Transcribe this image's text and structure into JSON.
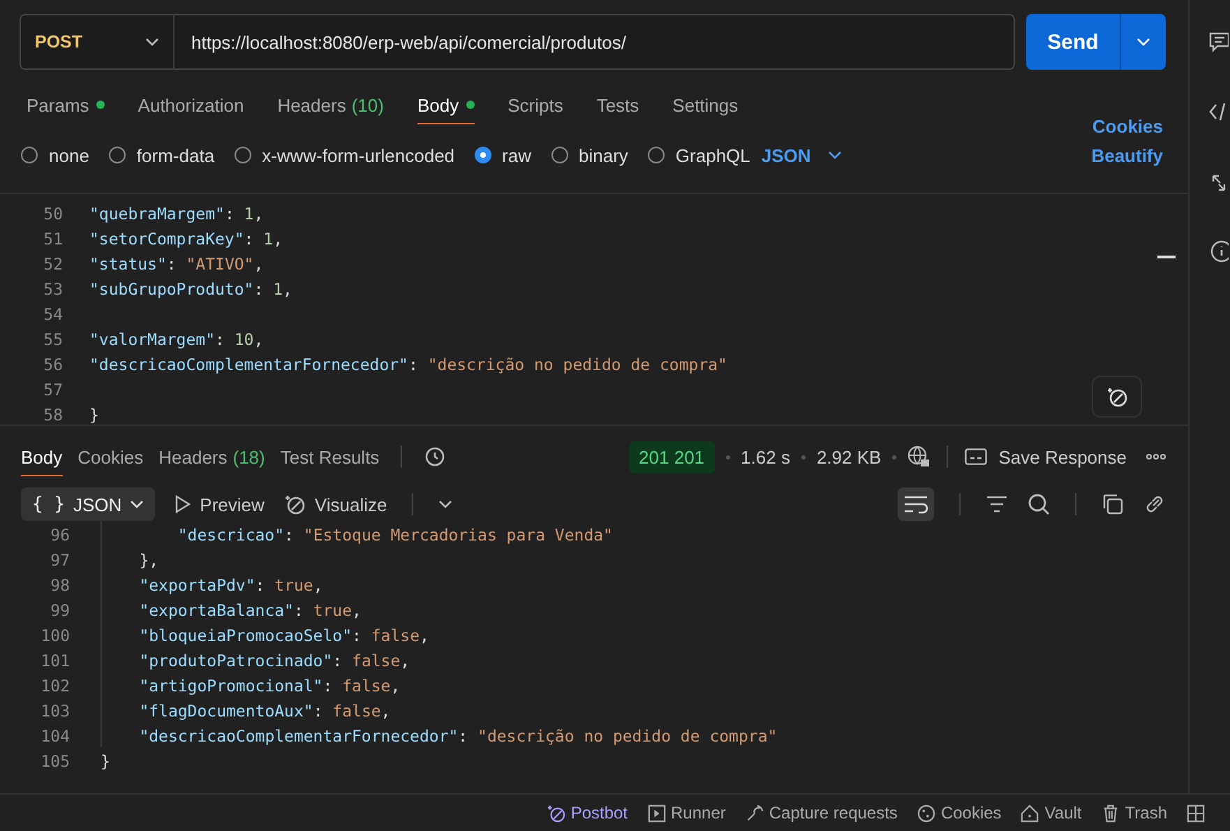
{
  "request": {
    "method": "POST",
    "url": "https://localhost:8080/erp-web/api/comercial/produtos/",
    "send": "Send"
  },
  "request_tabs": [
    {
      "label": "Params",
      "dot": true,
      "selected": false
    },
    {
      "label": "Authorization",
      "dot": false,
      "selected": false
    },
    {
      "label": "Headers",
      "count": "(10)",
      "dot": false,
      "selected": false
    },
    {
      "label": "Body",
      "dot": true,
      "selected": true
    },
    {
      "label": "Scripts",
      "dot": false,
      "selected": false
    },
    {
      "label": "Tests",
      "dot": false,
      "selected": false
    },
    {
      "label": "Settings",
      "dot": false,
      "selected": false
    }
  ],
  "cookies_link": "Cookies",
  "beautify_link": "Beautify",
  "body_types": [
    {
      "label": "none",
      "selected": false
    },
    {
      "label": "form-data",
      "selected": false
    },
    {
      "label": "x-www-form-urlencoded",
      "selected": false
    },
    {
      "label": "raw",
      "selected": true
    },
    {
      "label": "binary",
      "selected": false
    },
    {
      "label": "GraphQL",
      "selected": false
    }
  ],
  "body_format": "JSON",
  "request_body": [
    {
      "num": "50",
      "tokens": [
        {
          "kind": "key",
          "text": "\"quebraMargem\""
        },
        {
          "kind": "punct",
          "text": ": "
        },
        {
          "kind": "number",
          "text": "1"
        },
        {
          "kind": "punct",
          "text": ","
        }
      ]
    },
    {
      "num": "51",
      "tokens": [
        {
          "kind": "key",
          "text": "\"setorCompraKey\""
        },
        {
          "kind": "punct",
          "text": ": "
        },
        {
          "kind": "number",
          "text": "1"
        },
        {
          "kind": "punct",
          "text": ","
        }
      ]
    },
    {
      "num": "52",
      "tokens": [
        {
          "kind": "key",
          "text": "\"status\""
        },
        {
          "kind": "punct",
          "text": ": "
        },
        {
          "kind": "string",
          "text": "\"ATIVO\""
        },
        {
          "kind": "punct",
          "text": ","
        }
      ]
    },
    {
      "num": "53",
      "tokens": [
        {
          "kind": "key",
          "text": "\"subGrupoProduto\""
        },
        {
          "kind": "punct",
          "text": ": "
        },
        {
          "kind": "number",
          "text": "1"
        },
        {
          "kind": "punct",
          "text": ","
        }
      ]
    },
    {
      "num": "54"
    },
    {
      "num": "55",
      "tokens": [
        {
          "kind": "key",
          "text": "\"valorMargem\""
        },
        {
          "kind": "punct",
          "text": ": "
        },
        {
          "kind": "number",
          "text": "10"
        },
        {
          "kind": "punct",
          "text": ","
        }
      ]
    },
    {
      "num": "56",
      "tokens": [
        {
          "kind": "key",
          "text": "\"descricaoComplementarFornecedor\""
        },
        {
          "kind": "punct",
          "text": ": "
        },
        {
          "kind": "string",
          "text": "\"descrição no pedido de compra\""
        }
      ]
    },
    {
      "num": "57"
    },
    {
      "num": "58",
      "tokens": [
        {
          "kind": "punct",
          "text": "}"
        }
      ]
    }
  ],
  "response_tabs": [
    {
      "label": "Body",
      "selected": true
    },
    {
      "label": "Cookies",
      "selected": false
    },
    {
      "label": "Headers",
      "count": "(18)",
      "selected": false
    },
    {
      "label": "Test Results",
      "selected": false
    }
  ],
  "response_meta": {
    "status": "201 201",
    "time": "1.62 s",
    "size": "2.92 KB",
    "save": "Save Response"
  },
  "response_view": {
    "format_icon": "{ }",
    "format": "JSON",
    "preview": "Preview",
    "visualize": "Visualize"
  },
  "response_body": [
    {
      "children": [
        {
          "children": [
            {
              "num": "96",
              "tokens": [
                {
                  "kind": "key",
                  "text": "\"descricao\""
                },
                {
                  "kind": "punct",
                  "text": ": "
                },
                {
                  "kind": "string",
                  "text": "\"Estoque Mercadorias para Venda\""
                }
              ]
            }
          ]
        },
        {
          "num": "97",
          "tokens": [
            {
              "kind": "punct",
              "text": "},"
            }
          ]
        },
        {
          "num": "98",
          "tokens": [
            {
              "kind": "key",
              "text": "\"exportaPdv\""
            },
            {
              "kind": "punct",
              "text": ": "
            },
            {
              "kind": "bool",
              "text": "true"
            },
            {
              "kind": "punct",
              "text": ","
            }
          ]
        },
        {
          "num": "99",
          "tokens": [
            {
              "kind": "key",
              "text": "\"exportaBalanca\""
            },
            {
              "kind": "punct",
              "text": ": "
            },
            {
              "kind": "bool",
              "text": "true"
            },
            {
              "kind": "punct",
              "text": ","
            }
          ]
        },
        {
          "num": "100",
          "tokens": [
            {
              "kind": "key",
              "text": "\"bloqueiaPromocaoSelo\""
            },
            {
              "kind": "punct",
              "text": ": "
            },
            {
              "kind": "bool",
              "text": "false"
            },
            {
              "kind": "punct",
              "text": ","
            }
          ]
        },
        {
          "num": "101",
          "tokens": [
            {
              "kind": "key",
              "text": "\"produtoPatrocinado\""
            },
            {
              "kind": "punct",
              "text": ": "
            },
            {
              "kind": "bool",
              "text": "false"
            },
            {
              "kind": "punct",
              "text": ","
            }
          ]
        },
        {
          "num": "102",
          "tokens": [
            {
              "kind": "key",
              "text": "\"artigoPromocional\""
            },
            {
              "kind": "punct",
              "text": ": "
            },
            {
              "kind": "bool",
              "text": "false"
            },
            {
              "kind": "punct",
              "text": ","
            }
          ]
        },
        {
          "num": "103",
          "tokens": [
            {
              "kind": "key",
              "text": "\"flagDocumentoAux\""
            },
            {
              "kind": "punct",
              "text": ": "
            },
            {
              "kind": "bool",
              "text": "false"
            },
            {
              "kind": "punct",
              "text": ","
            }
          ]
        },
        {
          "num": "104",
          "tokens": [
            {
              "kind": "key",
              "text": "\"descricaoComplementarFornecedor\""
            },
            {
              "kind": "punct",
              "text": ": "
            },
            {
              "kind": "string",
              "text": "\"descrição no pedido de compra\""
            }
          ]
        }
      ]
    },
    {
      "num": "105",
      "tokens": [
        {
          "kind": "punct",
          "text": "}"
        }
      ]
    }
  ],
  "status_bar": [
    {
      "kind": "postbot",
      "label": "Postbot"
    },
    {
      "kind": "runner",
      "label": "Runner"
    },
    {
      "kind": "capture",
      "label": "Capture requests"
    },
    {
      "kind": "cookies",
      "label": "Cookies"
    },
    {
      "kind": "vault",
      "label": "Vault"
    },
    {
      "kind": "trash",
      "label": "Trash"
    }
  ]
}
